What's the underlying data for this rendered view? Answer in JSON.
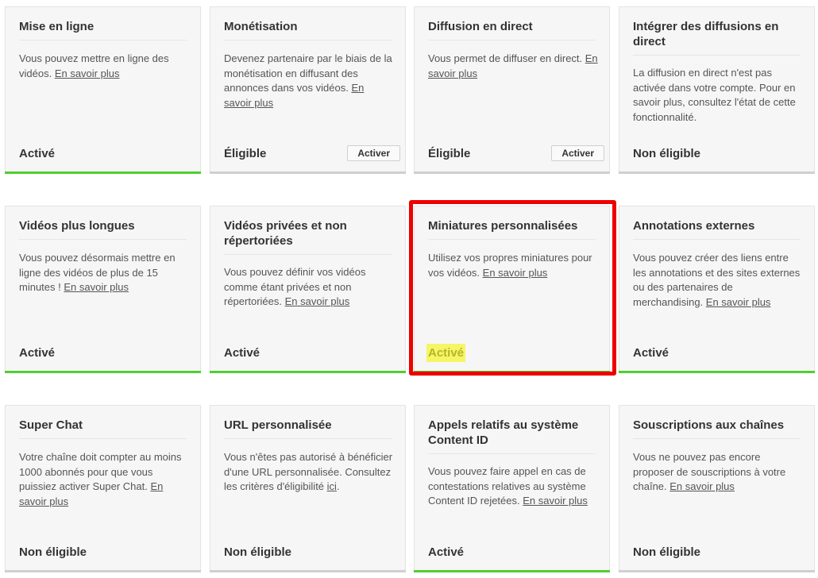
{
  "colors": {
    "active_bar": "#4fcf2f",
    "inactive_bar": "#cfcfcf",
    "highlight_box": "#ee0000",
    "highlight_text_bg": "#f5f566"
  },
  "cards": [
    {
      "title": "Mise en ligne",
      "desc": "Vous pouvez mettre en ligne des vidéos. ",
      "link": "En savoir plus",
      "after": "",
      "status": "Activé",
      "active": true
    },
    {
      "title": "Monétisation",
      "desc": "Devenez partenaire par le biais de la monétisation en diffusant des annonces dans vos vidéos. ",
      "link": "En savoir plus",
      "after": "",
      "status": "Éligible",
      "button": "Activer",
      "active": false
    },
    {
      "title": "Diffusion en direct",
      "desc": "Vous permet de diffuser en direct. ",
      "link": "En savoir plus",
      "after": "",
      "status": "Éligible",
      "button": "Activer",
      "active": false
    },
    {
      "title": "Intégrer des diffusions en direct",
      "desc": "La diffusion en direct n'est pas activée dans votre compte. Pour en savoir plus, consultez l'état de cette fonctionnalité.",
      "link": "",
      "after": "",
      "status": "Non éligible",
      "active": false
    },
    {
      "title": "Vidéos plus longues",
      "desc": "Vous pouvez désormais mettre en ligne des vidéos de plus de 15 minutes ! ",
      "link": "En savoir plus",
      "after": "",
      "status": "Activé",
      "active": true
    },
    {
      "title": "Vidéos privées et non répertoriées",
      "desc": "Vous pouvez définir vos vidéos comme étant privées et non répertoriées. ",
      "link": "En savoir plus",
      "after": "",
      "status": "Activé",
      "active": true
    },
    {
      "title": "Miniatures personnalisées",
      "desc": "Utilisez vos propres miniatures pour vos vidéos. ",
      "link": "En savoir plus",
      "after": "",
      "status": "Activé",
      "active": true,
      "highlighted": true
    },
    {
      "title": "Annotations externes",
      "desc": "Vous pouvez créer des liens entre les annotations et des sites externes ou des partenaires de merchandising. ",
      "link": "En savoir plus",
      "after": "",
      "status": "Activé",
      "active": true
    },
    {
      "title": "Super Chat",
      "desc": "Votre chaîne doit compter au moins 1000 abonnés pour que vous puissiez activer Super Chat. ",
      "link": "En savoir plus",
      "after": "",
      "status": "Non éligible",
      "active": false
    },
    {
      "title": "URL personnalisée",
      "desc": "Vous n'êtes pas autorisé à bénéficier d'une URL personnalisée. Consultez les critères d'éligibilité ",
      "link": "ici",
      "after": ".",
      "status": "Non éligible",
      "active": false
    },
    {
      "title": "Appels relatifs au système Content ID",
      "desc": "Vous pouvez faire appel en cas de contestations relatives au système Content ID rejetées. ",
      "link": "En savoir plus",
      "after": "",
      "status": "Activé",
      "active": true
    },
    {
      "title": "Souscriptions aux chaînes",
      "desc": "Vous ne pouvez pas encore proposer de souscriptions à votre chaîne. ",
      "link": "En savoir plus",
      "after": "",
      "status": "Non éligible",
      "active": false
    }
  ]
}
